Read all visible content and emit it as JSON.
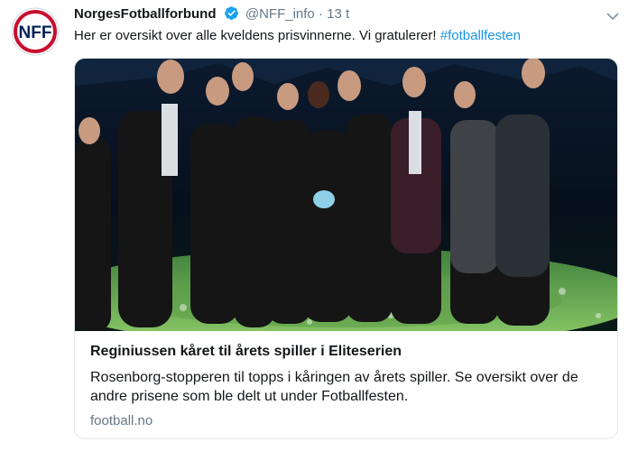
{
  "tweet": {
    "display_name": "NorgesFotballforbund",
    "handle": "@NFF_info",
    "separator": "·",
    "time": "13 t",
    "text_prefix": "Her er oversikt over alle kveldens prisvinnerne. Vi gratulerer! ",
    "hashtag": "#fotballfesten",
    "avatar_icon": "nff-logo-icon",
    "verified_icon": "verified-badge-icon",
    "menu_icon": "chevron-down-icon",
    "colors": {
      "link": "#1b95e0",
      "verified": "#1da1f2",
      "secondary": "#657786"
    }
  },
  "avatar_logo": {
    "letters": "NFF"
  },
  "card": {
    "title": "Reginiussen kåret til årets spiller i Eliteserien",
    "description": "Rosenborg-stopperen til topps i kåringen av årets spiller. Se oversikt over de andre prisene som ble delt ut under Fotballfesten.",
    "domain": "football.no"
  }
}
